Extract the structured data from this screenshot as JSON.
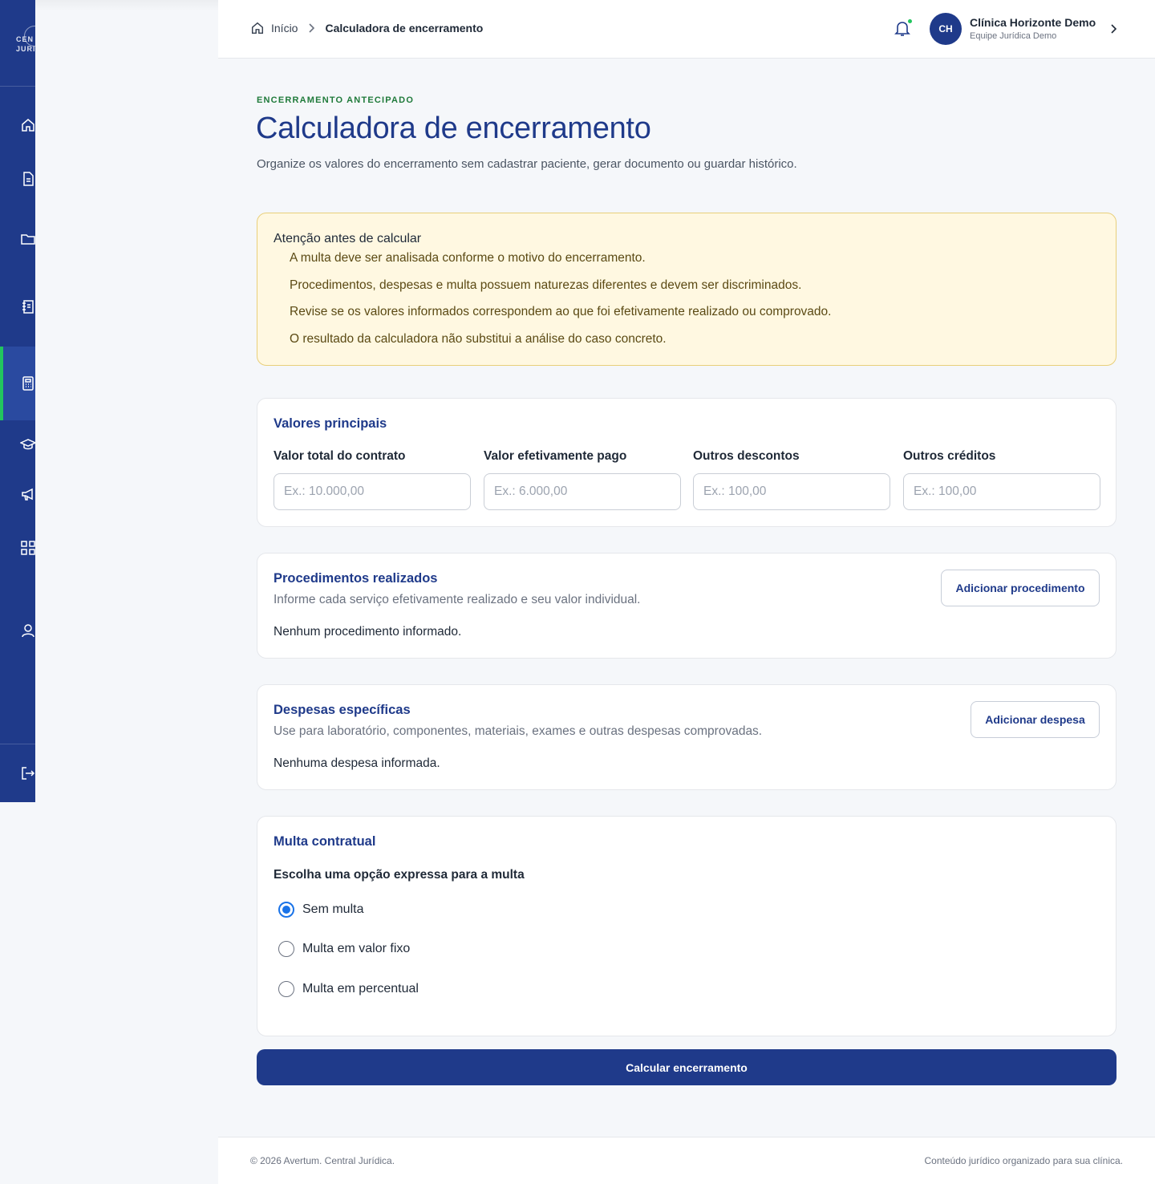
{
  "sidebar": {
    "logo_line1": "CEN",
    "logo_line2": "JURI",
    "items": [
      {
        "icon": "home-icon",
        "active": false
      },
      {
        "icon": "document-icon",
        "active": false
      },
      {
        "icon": "folder-icon",
        "active": false
      },
      {
        "icon": "notebook-icon",
        "active": false
      },
      {
        "icon": "calculator-icon",
        "active": true
      },
      {
        "icon": "graduation-cap-icon",
        "active": false
      },
      {
        "icon": "megaphone-icon",
        "active": false
      },
      {
        "icon": "grid-icon",
        "active": false
      },
      {
        "icon": "user-icon",
        "active": false
      },
      {
        "icon": "logout-icon",
        "active": false
      }
    ]
  },
  "header": {
    "breadcrumb_home": "Início",
    "breadcrumb_current": "Calculadora de encerramento",
    "avatar_initials": "CH",
    "user_name": "Clínica Horizonte Demo",
    "user_team": "Equipe Jurídica Demo"
  },
  "page": {
    "eyebrow": "ENCERRAMENTO ANTECIPADO",
    "title": "Calculadora de encerramento",
    "subtitle": "Organize os valores do encerramento sem cadastrar paciente, gerar documento ou guardar histórico."
  },
  "alert": {
    "title": "Atenção antes de calcular",
    "items": [
      "A multa deve ser analisada conforme o motivo do encerramento.",
      "Procedimentos, despesas e multa possuem naturezas diferentes e devem ser discriminados.",
      "Revise se os valores informados correspondem ao que foi efetivamente realizado ou comprovado.",
      "O resultado da calculadora não substitui a análise do caso concreto."
    ]
  },
  "main_values": {
    "title": "Valores principais",
    "fields": [
      {
        "label": "Valor total do contrato",
        "placeholder": "Ex.: 10.000,00",
        "value": ""
      },
      {
        "label": "Valor efetivamente pago",
        "placeholder": "Ex.: 6.000,00",
        "value": ""
      },
      {
        "label": "Outros descontos",
        "placeholder": "Ex.: 100,00",
        "value": ""
      },
      {
        "label": "Outros créditos",
        "placeholder": "Ex.: 100,00",
        "value": ""
      }
    ]
  },
  "procedures": {
    "title": "Procedimentos realizados",
    "description": "Informe cada serviço efetivamente realizado e seu valor individual.",
    "empty": "Nenhum procedimento informado.",
    "add_label": "Adicionar procedimento"
  },
  "expenses": {
    "title": "Despesas específicas",
    "description": "Use para laboratório, componentes, materiais, exames e outras despesas comprovadas.",
    "empty": "Nenhuma despesa informada.",
    "add_label": "Adicionar despesa"
  },
  "penalty": {
    "title": "Multa contratual",
    "question": "Escolha uma opção expressa para a multa",
    "options": [
      {
        "label": "Sem multa",
        "checked": true
      },
      {
        "label": "Multa em valor fixo",
        "checked": false
      },
      {
        "label": "Multa em percentual",
        "checked": false
      }
    ]
  },
  "submit_label": "Calcular encerramento",
  "footer": {
    "left": "© 2026 Avertum. Central Jurídica.",
    "right": "Conteúdo jurídico organizado para sua clínica."
  },
  "colors": {
    "primary": "#1f3a8a",
    "accent_green": "#22c55e",
    "radio_blue": "#1a73e8",
    "alert_bg": "#fff8e1"
  }
}
